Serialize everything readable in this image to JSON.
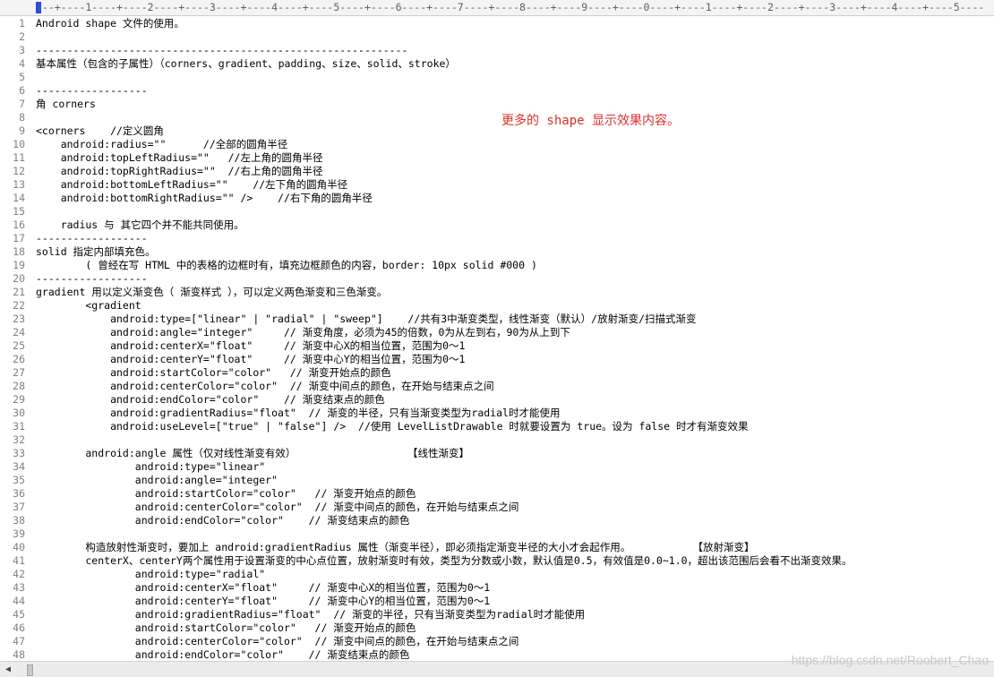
{
  "ruler": "---+----1----+----2----+----3----+----4----+----5----+----6----+----7----+----8----+----9----+----0----+----1----+----2----+----3----+----4----+----5----",
  "note": "更多的 shape 显示效果内容。",
  "watermark": "https://blog.csdn.net/Roobert_Chao",
  "lines": [
    {
      "n": "1",
      "text": "Android shape 文件的使用。"
    },
    {
      "n": "2",
      "text": ""
    },
    {
      "n": "3",
      "text": "------------------------------------------------------------"
    },
    {
      "n": "4",
      "text": "基本属性（包含的子属性）（corners、gradient、padding、size、solid、stroke）"
    },
    {
      "n": "5",
      "text": ""
    },
    {
      "n": "6",
      "text": "------------------"
    },
    {
      "n": "7",
      "text": "角 corners"
    },
    {
      "n": "8",
      "text": ""
    },
    {
      "n": "9",
      "text": "<corners    //定义圆角"
    },
    {
      "n": "10",
      "text": "    android:radius=\"\"      //全部的圆角半径"
    },
    {
      "n": "11",
      "text": "    android:topLeftRadius=\"\"   //左上角的圆角半径"
    },
    {
      "n": "12",
      "text": "    android:topRightRadius=\"\"  //右上角的圆角半径"
    },
    {
      "n": "13",
      "text": "    android:bottomLeftRadius=\"\"    //左下角的圆角半径"
    },
    {
      "n": "14",
      "text": "    android:bottomRightRadius=\"\" />    //右下角的圆角半径"
    },
    {
      "n": "15",
      "text": ""
    },
    {
      "n": "16",
      "text": "    radius 与 其它四个并不能共同使用。"
    },
    {
      "n": "17",
      "text": "------------------"
    },
    {
      "n": "18",
      "text": "solid 指定内部填充色。"
    },
    {
      "n": "19",
      "text": "        ( 曾经在写 HTML 中的表格的边框时有，填充边框颜色的内容，border: 10px solid #000 )"
    },
    {
      "n": "20",
      "text": "------------------"
    },
    {
      "n": "21",
      "text": "gradient 用以定义渐变色（ 渐变样式 ），可以定义两色渐变和三色渐变。"
    },
    {
      "n": "22",
      "text": "        <gradient"
    },
    {
      "n": "23",
      "text": "            android:type=[\"linear\" | \"radial\" | \"sweep\"]    //共有3中渐变类型，线性渐变（默认）/放射渐变/扫描式渐变"
    },
    {
      "n": "24",
      "text": "            android:angle=\"integer\"     // 渐变角度，必须为45的倍数，0为从左到右，90为从上到下"
    },
    {
      "n": "25",
      "text": "            android:centerX=\"float\"     // 渐变中心X的相当位置，范围为0～1"
    },
    {
      "n": "26",
      "text": "            android:centerY=\"float\"     // 渐变中心Y的相当位置，范围为0～1"
    },
    {
      "n": "27",
      "text": "            android:startColor=\"color\"   // 渐变开始点的颜色"
    },
    {
      "n": "28",
      "text": "            android:centerColor=\"color\"  // 渐变中间点的颜色，在开始与结束点之间"
    },
    {
      "n": "29",
      "text": "            android:endColor=\"color\"    // 渐变结束点的颜色"
    },
    {
      "n": "30",
      "text": "            android:gradientRadius=\"float\"  // 渐变的半径，只有当渐变类型为radial时才能使用"
    },
    {
      "n": "31",
      "text": "            android:useLevel=[\"true\" | \"false\"] />  //使用 LevelListDrawable 时就要设置为 true。设为 false 时才有渐变效果"
    },
    {
      "n": "32",
      "text": ""
    },
    {
      "n": "33",
      "text": "        android:angle 属性（仅对线性渐变有效）                  【线性渐变】"
    },
    {
      "n": "34",
      "text": "                android:type=\"linear\""
    },
    {
      "n": "35",
      "text": "                android:angle=\"integer\""
    },
    {
      "n": "36",
      "text": "                android:startColor=\"color\"   // 渐变开始点的颜色"
    },
    {
      "n": "37",
      "text": "                android:centerColor=\"color\"  // 渐变中间点的颜色，在开始与结束点之间"
    },
    {
      "n": "38",
      "text": "                android:endColor=\"color\"    // 渐变结束点的颜色"
    },
    {
      "n": "39",
      "text": ""
    },
    {
      "n": "40",
      "text": "        构造放射性渐变时，要加上 android:gradientRadius 属性（渐变半径），即必须指定渐变半径的大小才会起作用。          【放射渐变】"
    },
    {
      "n": "41",
      "text": "        centerX、centerY两个属性用于设置渐变的中心点位置，放射渐变时有效，类型为分数或小数，默认值是0.5，有效值是0.0~1.0，超出该范围后会看不出渐变效果。"
    },
    {
      "n": "42",
      "text": "                android:type=\"radial\""
    },
    {
      "n": "43",
      "text": "                android:centerX=\"float\"     // 渐变中心X的相当位置，范围为0～1"
    },
    {
      "n": "44",
      "text": "                android:centerY=\"float\"     // 渐变中心Y的相当位置，范围为0～1"
    },
    {
      "n": "45",
      "text": "                android:gradientRadius=\"float\"  // 渐变的半径，只有当渐变类型为radial时才能使用"
    },
    {
      "n": "46",
      "text": "                android:startColor=\"color\"   // 渐变开始点的颜色"
    },
    {
      "n": "47",
      "text": "                android:centerColor=\"color\"  // 渐变中间点的颜色，在开始与结束点之间"
    },
    {
      "n": "48",
      "text": "                android:endColor=\"color\"    // 渐变结束点的颜色"
    }
  ]
}
